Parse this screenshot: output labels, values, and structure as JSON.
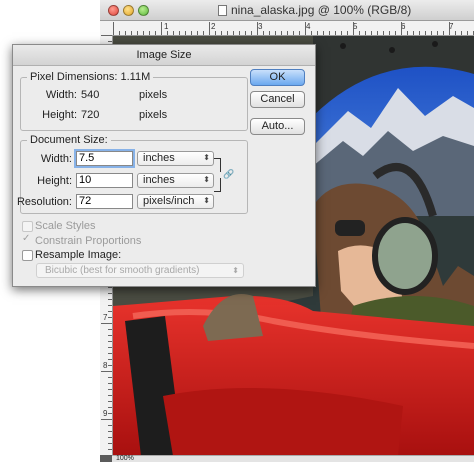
{
  "document_window": {
    "title": "nina_alaska.jpg @ 100% (RGB/8)",
    "ruler_top_numbers": [
      "1",
      "2",
      "3",
      "4",
      "5",
      "6",
      "7"
    ],
    "ruler_left_numbers": [
      "7",
      "8",
      "9"
    ],
    "status_zoom": "100%"
  },
  "dialog": {
    "title": "Image Size",
    "pixel_dimensions": {
      "legend": "Pixel Dimensions:",
      "size": "1.11M",
      "width_label": "Width:",
      "width_value": "540",
      "width_unit": "pixels",
      "height_label": "Height:",
      "height_value": "720",
      "height_unit": "pixels"
    },
    "document_size": {
      "legend": "Document Size:",
      "width_label": "Width:",
      "width_value": "7.5",
      "width_unit": "inches",
      "height_label": "Height:",
      "height_value": "10",
      "height_unit": "inches",
      "resolution_label": "Resolution:",
      "resolution_value": "72",
      "resolution_unit": "pixels/inch"
    },
    "buttons": {
      "ok": "OK",
      "cancel": "Cancel",
      "auto": "Auto..."
    },
    "options": {
      "scale_styles": "Scale Styles",
      "constrain_proportions": "Constrain Proportions",
      "resample_image": "Resample Image:",
      "resample_method": "Bicubic (best for smooth gradients)"
    }
  },
  "colors": {
    "default_button": "#6ba8ef",
    "field_focus": "#87b2e8"
  }
}
